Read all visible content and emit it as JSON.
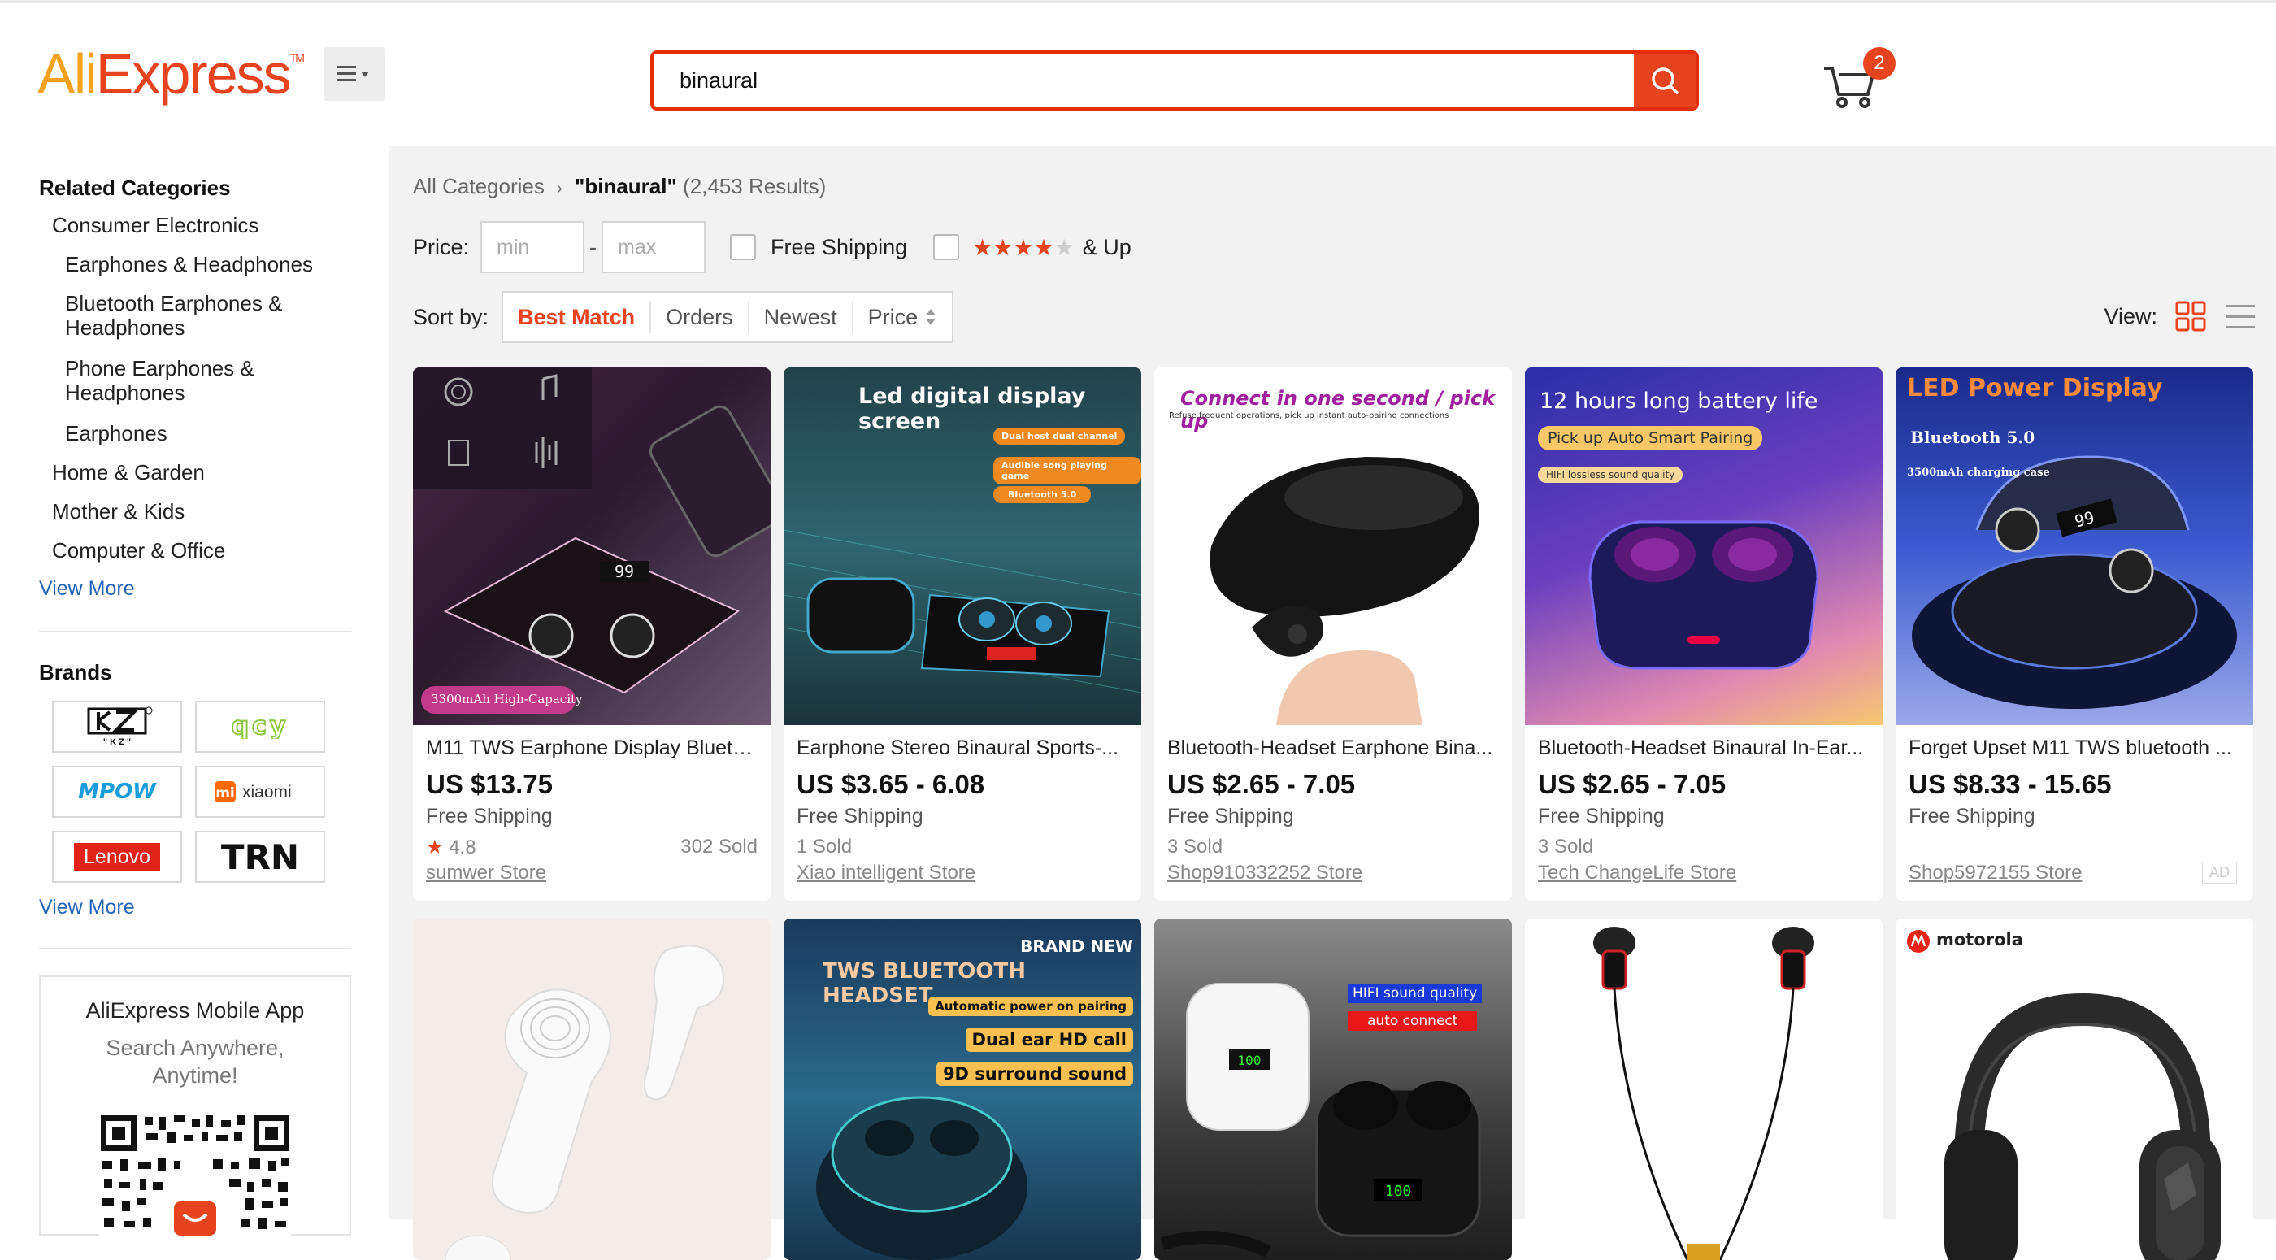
{
  "header": {
    "logo_ali": "Ali",
    "logo_express": "Express",
    "logo_tm": "TM",
    "search_value": "binaural",
    "cart_count": "2"
  },
  "sidebar": {
    "related_title": "Related Categories",
    "categories": [
      {
        "label": "Consumer Electronics"
      },
      {
        "label": "Earphones & Headphones"
      },
      {
        "label": "Bluetooth Earphones &"
      },
      {
        "label": "Headphones"
      },
      {
        "label": "Phone Earphones &"
      },
      {
        "label": "Headphones"
      },
      {
        "label": "Earphones"
      },
      {
        "label": "Home & Garden"
      },
      {
        "label": "Mother & Kids"
      },
      {
        "label": "Computer & Office"
      }
    ],
    "view_more_1": "View More",
    "brands_title": "Brands",
    "brands": [
      "KZ",
      "QCY",
      "MPOW",
      "xiaomi",
      "Lenovo",
      "TRN"
    ],
    "view_more_2": "View More",
    "app_title": "AliExpress Mobile App",
    "app_sub1": "Search Anywhere,",
    "app_sub2": "Anytime!"
  },
  "main": {
    "breadcrumb_all": "All Categories",
    "breadcrumb_query": "\"binaural\"",
    "breadcrumb_count": "(2,453 Results)",
    "price_label": "Price:",
    "price_min_placeholder": "min",
    "price_dash": "-",
    "price_max_placeholder": "max",
    "free_shipping_label": "Free Shipping",
    "rating_up_label": "& Up",
    "sort_label": "Sort by:",
    "sort_options": [
      "Best Match",
      "Orders",
      "Newest",
      "Price"
    ],
    "view_label": "View:"
  },
  "products": [
    {
      "title": "M11 TWS Earphone Display Blueto...",
      "price": "US $13.75",
      "shipping": "Free Shipping",
      "rating": "4.8",
      "sold": "302 Sold",
      "store": "sumwer Store",
      "img_text": "3300mAh High-Capacity"
    },
    {
      "title": "Earphone Stereo Binaural Sports-...",
      "price": "US $3.65 - 6.08",
      "shipping": "Free Shipping",
      "sold": "1 Sold",
      "store": "Xiao intelligent Store",
      "img_text": "Led digital display screen",
      "img_tags": [
        "Dual host dual channel",
        "Audible song playing game",
        "Bluetooth 5.0"
      ]
    },
    {
      "title": "Bluetooth-Headset Earphone Bina...",
      "price": "US $2.65 - 7.05",
      "shipping": "Free Shipping",
      "sold": "3 Sold",
      "store": "Shop910332252 Store",
      "img_text": "Connect in one second / pick up",
      "img_sub": "Refuse frequent operations, pick up instant auto-pairing connections"
    },
    {
      "title": "Bluetooth-Headset Binaural In-Ear...",
      "price": "US $2.65 - 7.05",
      "shipping": "Free Shipping",
      "sold": "3 Sold",
      "store": "Tech ChangeLife Store",
      "img_text": "12 hours long battery life",
      "img_tags": [
        "Pick up Auto Smart Pairing",
        "HIFI lossless sound quality"
      ]
    },
    {
      "title": "Forget Upset M11 TWS bluetooth ...",
      "price": "US $8.33 - 15.65",
      "shipping": "Free Shipping",
      "store": "Shop5972155 Store",
      "ad": "AD",
      "img_text": "LED Power Display",
      "img_tags": [
        "Bluetooth 5.0",
        "3500mAh charging case"
      ]
    },
    {
      "img_text": ""
    },
    {
      "img_text": "TWS BLUETOOTH HEADSET",
      "img_sub": "BRAND NEW",
      "img_tags": [
        "Automatic power on pairing",
        "Dual ear HD call",
        "9D surround sound"
      ]
    },
    {
      "img_text": "",
      "img_tags": [
        "HIFI sound quality",
        "auto connect"
      ]
    },
    {
      "img_text": ""
    },
    {
      "img_text": "motorola"
    }
  ],
  "colors": {
    "accent": "#e8431f",
    "brand_orange": "#f7a21b",
    "link": "#2563b6"
  }
}
